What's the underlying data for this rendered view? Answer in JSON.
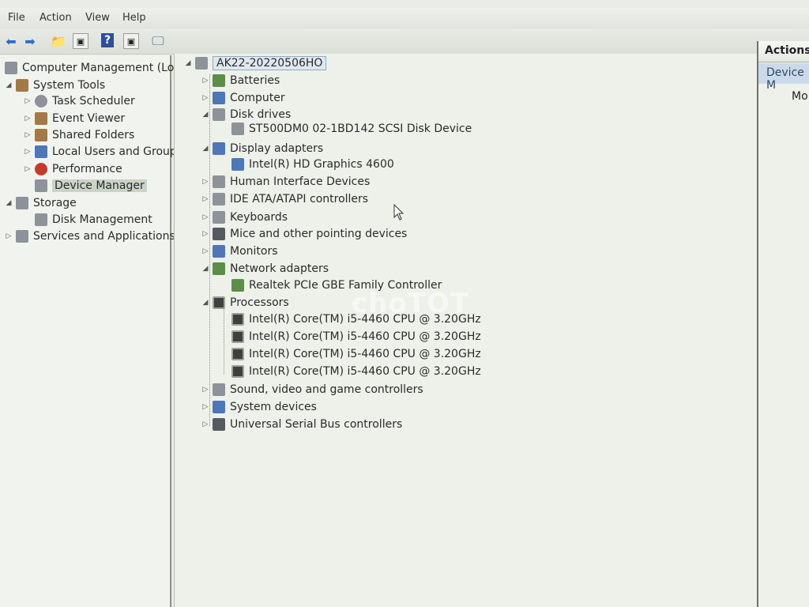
{
  "menu": [
    "File",
    "Action",
    "View",
    "Help"
  ],
  "toolbar": {
    "icons": [
      "back-arrow-icon",
      "forward-arrow-icon",
      "up-folder-icon",
      "console-tree-icon",
      "help-icon",
      "properties-icon",
      "scan-hardware-icon"
    ]
  },
  "left_tree": {
    "root": "Computer Management (Local",
    "system_tools": "System Tools",
    "task_scheduler": "Task Scheduler",
    "event_viewer": "Event Viewer",
    "shared_folders": "Shared Folders",
    "local_users": "Local Users and Groups",
    "performance": "Performance",
    "device_manager": "Device Manager",
    "storage": "Storage",
    "disk_management": "Disk Management",
    "services": "Services and Applications"
  },
  "device_tree": {
    "computer_name": "AK22-20220506HO",
    "categories": {
      "batteries": "Batteries",
      "computer": "Computer",
      "disk_drives": "Disk drives",
      "disk_device": "ST500DM0 02-1BD142 SCSI Disk Device",
      "display_adapters": "Display adapters",
      "gpu": "Intel(R) HD Graphics 4600",
      "hid": "Human Interface Devices",
      "ide": "IDE ATA/ATAPI controllers",
      "keyboards": "Keyboards",
      "mice": "Mice and other pointing devices",
      "monitors": "Monitors",
      "network_adapters": "Network adapters",
      "nic": "Realtek PCIe GBE Family Controller",
      "processors": "Processors",
      "cpu": "Intel(R) Core(TM) i5-4460  CPU @ 3.20GHz",
      "sound": "Sound, video and game controllers",
      "system_devices": "System devices",
      "usb": "Universal Serial Bus controllers"
    }
  },
  "actions_pane": {
    "title": "Actions",
    "section": "Device M",
    "more": "Mo"
  },
  "watermark": "choTOT"
}
